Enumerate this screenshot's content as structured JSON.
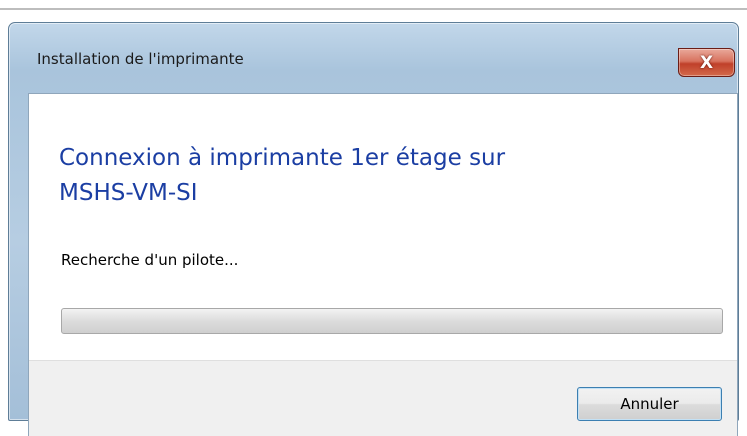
{
  "window": {
    "title": "Installation de l'imprimante",
    "close_label": "X"
  },
  "main": {
    "heading_line1": "Connexion à imprimante 1er étage sur",
    "heading_line2": "MSHS-VM-SI",
    "status_text": "Recherche d'un pilote...",
    "progress": 0
  },
  "footer": {
    "cancel_label": "Annuler"
  },
  "colors": {
    "heading": "#1b3ea3",
    "close_button": "#c0402a",
    "title_bar": "#b6cde2"
  }
}
